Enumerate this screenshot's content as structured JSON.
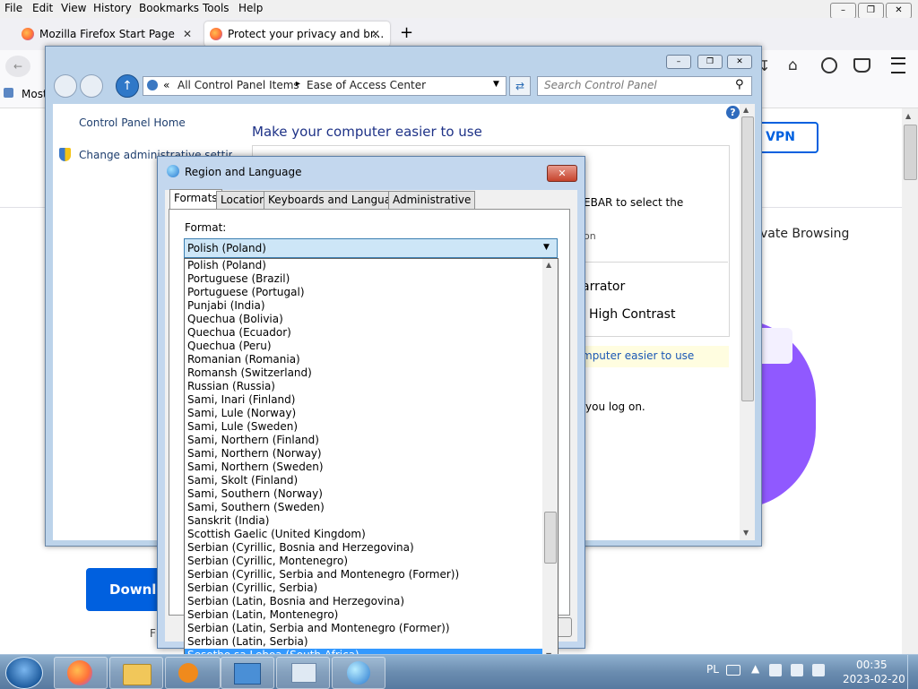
{
  "firefox": {
    "menu": [
      "File",
      "Edit",
      "View",
      "History",
      "Bookmarks",
      "Tools",
      "Help"
    ],
    "window_controls": [
      "–",
      "❐",
      "✕"
    ],
    "tabs": [
      {
        "title": "Mozilla Firefox Start Page",
        "close": "✕"
      },
      {
        "title": "Protect your privacy and br...",
        "close": "✕"
      }
    ],
    "new_tab": "+",
    "bookmarks_first": "Most",
    "page": {
      "vpn_button": "VPN",
      "private_browsing": "vate Browsing",
      "download_button": "Downlo",
      "footer_fragment": "F"
    }
  },
  "control_panel": {
    "window_controls": [
      "–",
      "❐",
      "✕"
    ],
    "address": {
      "prefix": "«",
      "crumb1": "All Control Panel Items",
      "sep": "▸",
      "crumb2": "Ease of Access Center"
    },
    "search_placeholder": "Search Control Panel",
    "left_links": [
      "Control Panel Home",
      "Change administrative settings"
    ],
    "main": {
      "heading": "Make your computer easier to use",
      "text1": "EBAR to select the",
      "text2": "on",
      "text3": "arrator",
      "text4": "High Contrast",
      "highlight": "mputer easier to use",
      "text5": "you log on."
    }
  },
  "region_dialog": {
    "title": "Region and Language",
    "close": "✕",
    "tabs": [
      "Formats",
      "Location",
      "Keyboards and Languages",
      "Administrative"
    ],
    "format_label": "Format:",
    "selected_format": "Polish (Poland)",
    "options": [
      "Polish (Poland)",
      "Portuguese (Brazil)",
      "Portuguese (Portugal)",
      "Punjabi (India)",
      "Quechua (Bolivia)",
      "Quechua (Ecuador)",
      "Quechua (Peru)",
      "Romanian (Romania)",
      "Romansh (Switzerland)",
      "Russian (Russia)",
      "Sami, Inari (Finland)",
      "Sami, Lule (Norway)",
      "Sami, Lule (Sweden)",
      "Sami, Northern (Finland)",
      "Sami, Northern (Norway)",
      "Sami, Northern (Sweden)",
      "Sami, Skolt (Finland)",
      "Sami, Southern (Norway)",
      "Sami, Southern (Sweden)",
      "Sanskrit (India)",
      "Scottish Gaelic (United Kingdom)",
      "Serbian (Cyrillic, Bosnia and Herzegovina)",
      "Serbian (Cyrillic, Montenegro)",
      "Serbian (Cyrillic, Serbia and Montenegro (Former))",
      "Serbian (Cyrillic, Serbia)",
      "Serbian (Latin, Bosnia and Herzegovina)",
      "Serbian (Latin, Montenegro)",
      "Serbian (Latin, Serbia and Montenegro (Former))",
      "Serbian (Latin, Serbia)",
      "Sesotho sa Leboa (South Africa)"
    ],
    "highlighted_option": "Sesotho sa Leboa (South Africa)"
  },
  "taskbar": {
    "language": "PL",
    "time": "00:35",
    "date": "2023-02-20"
  }
}
